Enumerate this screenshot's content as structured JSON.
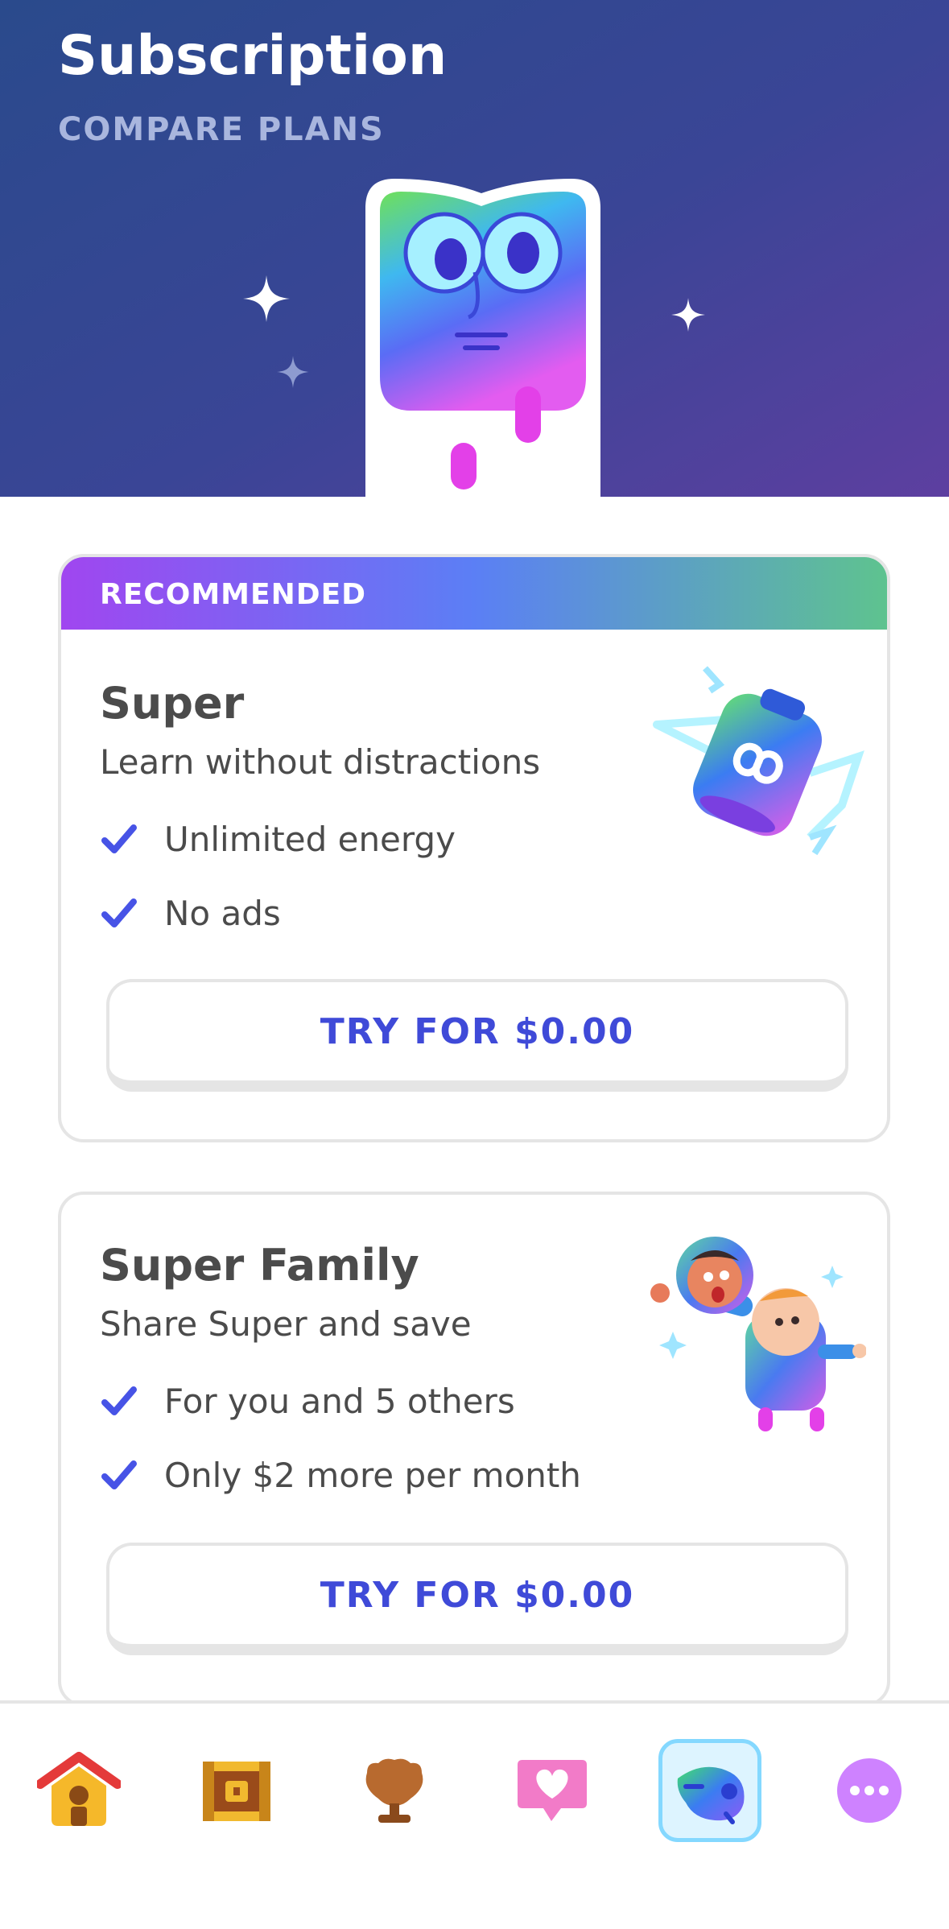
{
  "header": {
    "title": "Subscription",
    "subtitle": "COMPARE PLANS"
  },
  "plans": [
    {
      "badge": "RECOMMENDED",
      "title": "Super",
      "description": "Learn without distractions",
      "features": [
        "Unlimited energy",
        "No ads"
      ],
      "cta": "TRY FOR $0.00"
    },
    {
      "title": "Super Family",
      "description": "Share Super and save",
      "features": [
        "For you and 5 others",
        "Only $2 more per month"
      ],
      "cta": "TRY FOR $0.00"
    }
  ],
  "nav": {
    "items": [
      {
        "icon": "home-icon",
        "active": false
      },
      {
        "icon": "treasure-chest-icon",
        "active": false
      },
      {
        "icon": "trophy-icon",
        "active": false
      },
      {
        "icon": "heart-chat-icon",
        "active": false
      },
      {
        "icon": "super-owl-icon",
        "active": true
      },
      {
        "icon": "more-icon",
        "active": false
      }
    ]
  },
  "colors": {
    "accent": "#3f4ad8",
    "check": "#4753e6",
    "border": "#e5e5e5",
    "text": "#4b4b4b"
  }
}
